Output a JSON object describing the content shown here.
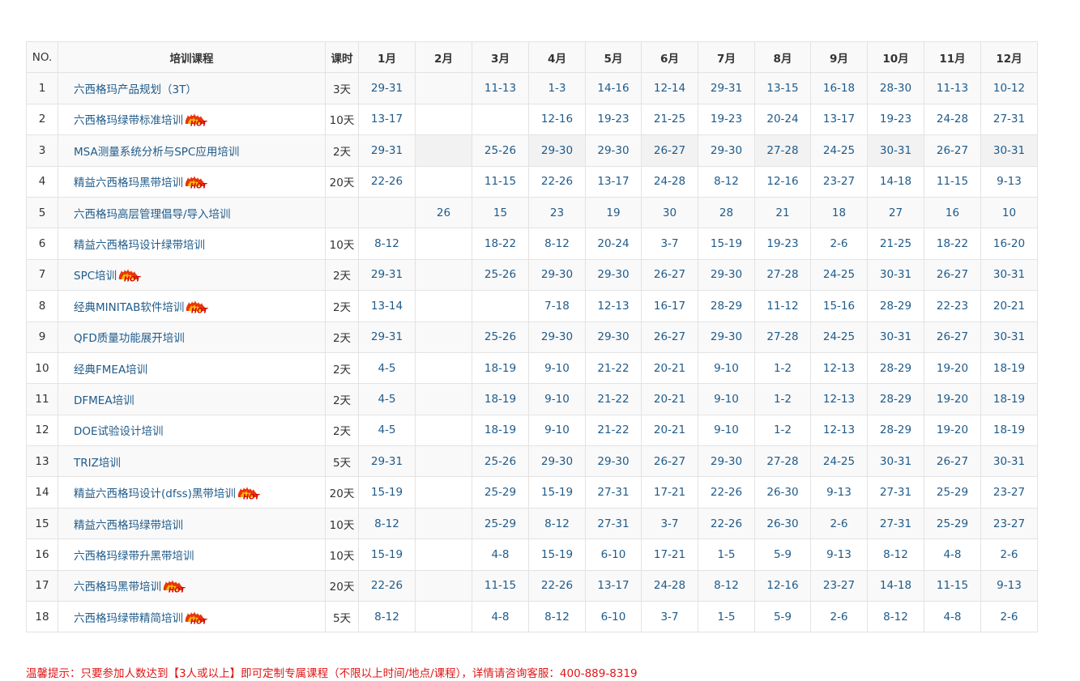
{
  "table": {
    "headers": {
      "no": "NO.",
      "course": "培训课程",
      "hours": "课时",
      "months": [
        "1月",
        "2月",
        "3月",
        "4月",
        "5月",
        "6月",
        "7月",
        "8月",
        "9月",
        "10月",
        "11月",
        "12月"
      ]
    },
    "hot_label": "HOT",
    "rows": [
      {
        "no": "1",
        "course": "六西格玛产品规划（3T）",
        "hot": false,
        "hours": "3天",
        "months": [
          "29-31",
          "",
          "11-13",
          "1-3",
          "14-16",
          "12-14",
          "29-31",
          "13-15",
          "16-18",
          "28-30",
          "11-13",
          "10-12"
        ]
      },
      {
        "no": "2",
        "course": "六西格玛绿带标准培训",
        "hot": true,
        "hours": "10天",
        "months": [
          "13-17",
          "",
          "",
          "12-16",
          "19-23",
          "21-25",
          "19-23",
          "20-24",
          "13-17",
          "19-23",
          "24-28",
          "27-31"
        ]
      },
      {
        "no": "3",
        "course": "MSA测量系统分析与SPC应用培训",
        "hot": false,
        "hours": "2天",
        "months": [
          "29-31",
          "",
          "25-26",
          "29-30",
          "29-30",
          "26-27",
          "29-30",
          "27-28",
          "24-25",
          "30-31",
          "26-27",
          "30-31"
        ]
      },
      {
        "no": "4",
        "course": "精益六西格玛黑带培训",
        "hot": true,
        "hours": "20天",
        "months": [
          "22-26",
          "",
          "11-15",
          "22-26",
          "13-17",
          "24-28",
          "8-12",
          "12-16",
          "23-27",
          "14-18",
          "11-15",
          "9-13"
        ]
      },
      {
        "no": "5",
        "course": "六西格玛高层管理倡导/导入培训",
        "hot": false,
        "hours": "",
        "months": [
          "",
          "26",
          "15",
          "23",
          "19",
          "30",
          "28",
          "21",
          "18",
          "27",
          "16",
          "10"
        ]
      },
      {
        "no": "6",
        "course": "精益六西格玛设计绿带培训",
        "hot": false,
        "hours": "10天",
        "months": [
          "8-12",
          "",
          "18-22",
          "8-12",
          "20-24",
          "3-7",
          "15-19",
          "19-23",
          "2-6",
          "21-25",
          "18-22",
          "16-20"
        ]
      },
      {
        "no": "7",
        "course": "SPC培训",
        "hot": true,
        "hours": "2天",
        "months": [
          "29-31",
          "",
          "25-26",
          "29-30",
          "29-30",
          "26-27",
          "29-30",
          "27-28",
          "24-25",
          "30-31",
          "26-27",
          "30-31"
        ]
      },
      {
        "no": "8",
        "course": "经典MINITAB软件培训",
        "hot": true,
        "hours": "2天",
        "months": [
          "13-14",
          "",
          "",
          "7-18",
          "12-13",
          "16-17",
          "28-29",
          "11-12",
          "15-16",
          "28-29",
          "22-23",
          "20-21"
        ]
      },
      {
        "no": "9",
        "course": "QFD质量功能展开培训",
        "hot": false,
        "hours": "2天",
        "months": [
          "29-31",
          "",
          "25-26",
          "29-30",
          "29-30",
          "26-27",
          "29-30",
          "27-28",
          "24-25",
          "30-31",
          "26-27",
          "30-31"
        ]
      },
      {
        "no": "10",
        "course": "经典FMEA培训",
        "hot": false,
        "hours": "2天",
        "months": [
          "4-5",
          "",
          "18-19",
          "9-10",
          "21-22",
          "20-21",
          "9-10",
          "1-2",
          "12-13",
          "28-29",
          "19-20",
          "18-19"
        ]
      },
      {
        "no": "11",
        "course": "DFMEA培训",
        "hot": false,
        "hours": "2天",
        "months": [
          "4-5",
          "",
          "18-19",
          "9-10",
          "21-22",
          "20-21",
          "9-10",
          "1-2",
          "12-13",
          "28-29",
          "19-20",
          "18-19"
        ]
      },
      {
        "no": "12",
        "course": "DOE试验设计培训",
        "hot": false,
        "hours": "2天",
        "months": [
          "4-5",
          "",
          "18-19",
          "9-10",
          "21-22",
          "20-21",
          "9-10",
          "1-2",
          "12-13",
          "28-29",
          "19-20",
          "18-19"
        ]
      },
      {
        "no": "13",
        "course": "TRIZ培训",
        "hot": false,
        "hours": "5天",
        "months": [
          "29-31",
          "",
          "25-26",
          "29-30",
          "29-30",
          "26-27",
          "29-30",
          "27-28",
          "24-25",
          "30-31",
          "26-27",
          "30-31"
        ]
      },
      {
        "no": "14",
        "course": "精益六西格玛设计(dfss)黑带培训",
        "hot": true,
        "hours": "20天",
        "months": [
          "15-19",
          "",
          "25-29",
          "15-19",
          "27-31",
          "17-21",
          "22-26",
          "26-30",
          "9-13",
          "27-31",
          "25-29",
          "23-27"
        ]
      },
      {
        "no": "15",
        "course": "精益六西格玛绿带培训",
        "hot": false,
        "hours": "10天",
        "months": [
          "8-12",
          "",
          "25-29",
          "8-12",
          "27-31",
          "3-7",
          "22-26",
          "26-30",
          "2-6",
          "27-31",
          "25-29",
          "23-27"
        ]
      },
      {
        "no": "16",
        "course": "六西格玛绿带升黑带培训",
        "hot": false,
        "hours": "10天",
        "months": [
          "15-19",
          "",
          "4-8",
          "15-19",
          "6-10",
          "17-21",
          "1-5",
          "5-9",
          "9-13",
          "8-12",
          "4-8",
          "2-6"
        ]
      },
      {
        "no": "17",
        "course": "六西格玛黑带培训",
        "hot": true,
        "hours": "20天",
        "months": [
          "22-26",
          "",
          "11-15",
          "22-26",
          "13-17",
          "24-28",
          "8-12",
          "12-16",
          "23-27",
          "14-18",
          "11-15",
          "9-13"
        ]
      },
      {
        "no": "18",
        "course": "六西格玛绿带精简培训",
        "hot": true,
        "hours": "5天",
        "months": [
          "8-12",
          "",
          "4-8",
          "8-12",
          "6-10",
          "3-7",
          "1-5",
          "5-9",
          "2-6",
          "8-12",
          "4-8",
          "2-6"
        ]
      }
    ]
  },
  "tip": "温馨提示：只要参加人数达到【3人或以上】即可定制专属课程（不限以上时间/地点/课程），详情请咨询客服：400-889-8319",
  "colors": {
    "link": "#1f5b8a",
    "tip": "#e01515",
    "hot_flame": "#e8360c",
    "border": "#e3e3e3"
  },
  "icons": {
    "hot_badge": "hot-flame-icon"
  }
}
